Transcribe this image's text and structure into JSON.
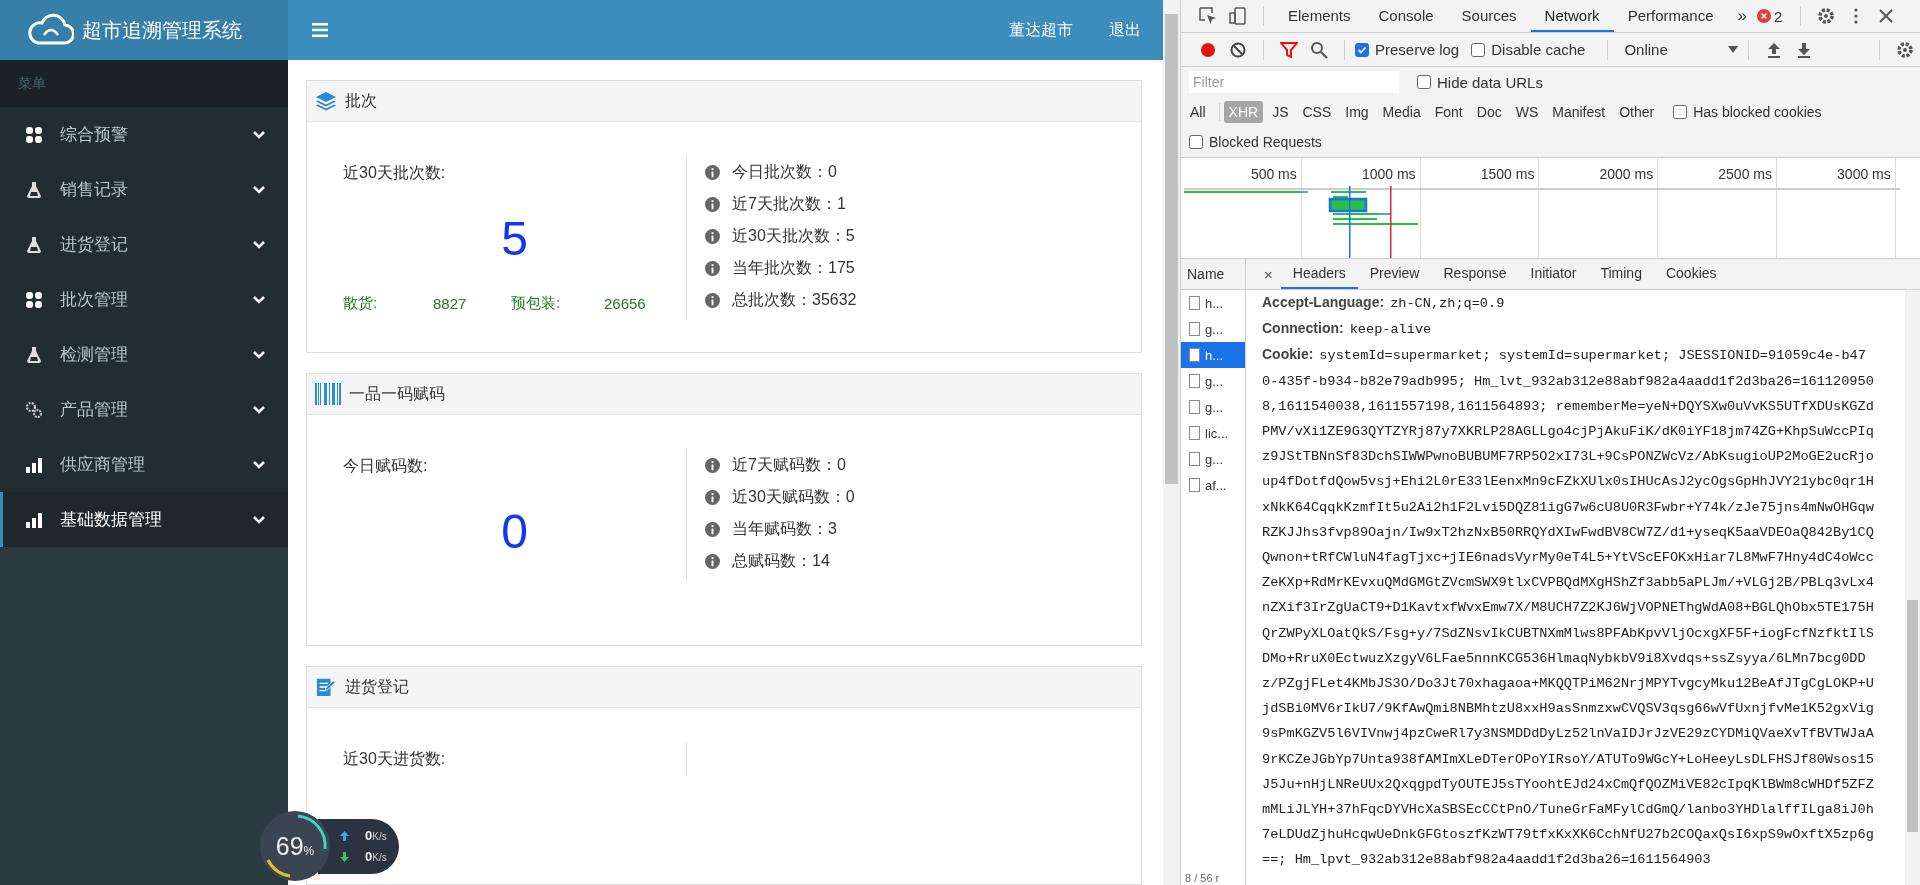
{
  "app": {
    "title": "超市追溯管理系统",
    "user": "董达超市",
    "logout": "退出"
  },
  "sidebar": {
    "heading": "菜单",
    "items": [
      {
        "label": "综合预警",
        "selected": false
      },
      {
        "label": "销售记录",
        "selected": false
      },
      {
        "label": "进货登记",
        "selected": false
      },
      {
        "label": "批次管理",
        "selected": false
      },
      {
        "label": "检测管理",
        "selected": false
      },
      {
        "label": "产品管理",
        "selected": false
      },
      {
        "label": "供应商管理",
        "selected": false
      },
      {
        "label": "基础数据管理",
        "selected": true
      }
    ]
  },
  "cards": [
    {
      "title": "批次",
      "main_label": "近30天批次数:",
      "main_value": "5",
      "breakdown": [
        {
          "label": "散货:",
          "value": "8827"
        },
        {
          "label": "预包装:",
          "value": "26656"
        }
      ],
      "stats": [
        "今日批次数：0",
        "近7天批次数：1",
        "近30天批次数：5",
        "当年批次数：175",
        "总批次数：35632"
      ]
    },
    {
      "title": "一品一码赋码",
      "main_label": "今日赋码数:",
      "main_value": "0",
      "stats": [
        "近7天赋码数：0",
        "近30天赋码数：0",
        "当年赋码数：3",
        "总赋码数：14"
      ]
    },
    {
      "title": "进货登记",
      "main_label": "近30天进货数:"
    }
  ],
  "speed_widget": {
    "percent": "69",
    "percent_unit": "%",
    "upload": "0",
    "upload_unit": "K/s",
    "download": "0",
    "download_unit": "K/s"
  },
  "devtools": {
    "tabs": [
      {
        "label": "Elements",
        "selected": false
      },
      {
        "label": "Console",
        "selected": false
      },
      {
        "label": "Sources",
        "selected": false
      },
      {
        "label": "Network",
        "selected": true
      },
      {
        "label": "Performance",
        "selected": false
      }
    ],
    "more": "»",
    "errors": "2",
    "preserve_log": {
      "label": "Preserve log",
      "checked": true
    },
    "disable_cache": {
      "label": "Disable cache",
      "checked": false
    },
    "throttling": "Online",
    "filter": {
      "placeholder": "Filter"
    },
    "hide_data_urls": {
      "label": "Hide data URLs",
      "checked": false
    },
    "types": [
      {
        "label": "All",
        "selected": false
      },
      {
        "label": "XHR",
        "selected": true
      },
      {
        "label": "JS",
        "selected": false
      },
      {
        "label": "CSS",
        "selected": false
      },
      {
        "label": "Img",
        "selected": false
      },
      {
        "label": "Media",
        "selected": false
      },
      {
        "label": "Font",
        "selected": false
      },
      {
        "label": "Doc",
        "selected": false
      },
      {
        "label": "WS",
        "selected": false
      },
      {
        "label": "Manifest",
        "selected": false
      },
      {
        "label": "Other",
        "selected": false
      }
    ],
    "has_blocked_cookies": {
      "label": "Has blocked cookies",
      "checked": false
    },
    "blocked_requests": {
      "label": "Blocked Requests",
      "checked": false
    },
    "timeline": {
      "ticks": [
        "500 ms",
        "1000 ms",
        "1500 ms",
        "2000 ms",
        "2500 ms",
        "3000 ms"
      ]
    },
    "requests": {
      "heading": "Name",
      "rows": [
        {
          "name": "h...",
          "selected": false
        },
        {
          "name": "g...",
          "selected": false
        },
        {
          "name": "h...",
          "selected": true
        },
        {
          "name": "g...",
          "selected": false
        },
        {
          "name": "g...",
          "selected": false
        },
        {
          "name": "lic...",
          "selected": false
        },
        {
          "name": "g...",
          "selected": false
        },
        {
          "name": "af...",
          "selected": false
        }
      ],
      "summary": "8 / 56 r"
    },
    "details": {
      "close": "×",
      "tabs": [
        {
          "label": "Headers",
          "selected": true
        },
        {
          "label": "Preview",
          "selected": false
        },
        {
          "label": "Response",
          "selected": false
        },
        {
          "label": "Initiator",
          "selected": false
        },
        {
          "label": "Timing",
          "selected": false
        },
        {
          "label": "Cookies",
          "selected": false
        }
      ],
      "headers": [
        {
          "name": "Accept-Language:",
          "value": "zh-CN,zh;q=0.9"
        },
        {
          "name": "Connection:",
          "value": "keep-alive"
        },
        {
          "name": "Cookie:",
          "value": "systemId=supermarket; systemId=supermarket; JSESSIONID=91059c4e-b470-435f-b934-b82e79adb995; Hm_lvt_932ab312e88abf982a4aadd1f2d3ba26=1611209508,1611540038,1611557198,1611564893; rememberMe=yeN+DQYSXw0uVvKS5UTfXDUsKGZdPMV/vXi1ZE9G3QYTZYRj87y7XKRLP28AGLLgo4cjPjAkuFiK/dK0iYF18jm74ZG+KhpSuWccPIqz9JStTBNnSf83DchSIWWPwnoBUBUMF7RP5O2xI73L+9CsPONZWcVz/AbKsugioUP2MoGE2ucRjoup4fDotfdQow5vsj+Ehi2L0rE33lEenxMn9cFZkXUlx0sIHUcAsJ2ycOgsGpHhJVY21ybc0qr1HxNkK64CqqkKzmfIt5u2Ai2h1F2Lvi5DQZ81igG7w6cU8U0R3Fwbr+Y74k/zJe75jns4mNwOHGqwRZKJJhs3fvp89Oajn/Iw9xT2hzNxB50RRQYdXIwFwdBV8CW7Z/d1+yseqK5aaVDEOaQ842By1CQQwnon+tRfCWluN4fagTjxc+jIE6nadsVyrMy0eT4L5+YtVScEFOKxHiar7L8MwF7Hny4dC4oWccZeKXp+RdMrKEvxuQMdGMGtZVcmSWX9tlxCVPBQdMXgHShZf3abb5aPLJm/+VLGj2B/PBLq3vLx4nZXif3IrZgUaCT9+D1KavtxfWvxEmw7X/M8UCH7Z2KJ6WjVOPNEThgWdA08+BGLQhObx5TE175HQrZWPyXLOatQkS/Fsg+y/7SdZNsvIkCUBTNXmMlws8PFAbKpvVljOcxgXF5F+iogFcfNzfktIlSDMo+RruX0EctwuzXzgyV6LFae5nnnKCG536HlmaqNybkbV9i8Xvdqs+ssZsyya/6LMn7bcg0DDz/PZgjFLet4KMbJS3O/Do3Jt70xhagaoa+MKQQTPiM62NrjMPYTvgcyMku12BeAfJTgCgLOKP+UjdSBi0MV6rIkU7/9KfAwQmi8NBMhtzU8xxH9asSnmzxwCVQSV3qsg66wVfUxnjfvMe1K52gxVig9sPmKGZV5l6VIVnwj4pzCweRl7y3NSMDDdDyLz52lnVaIDJrJzVE29zCYDMiQVaeXvTfBVTWJaA9rKCZeJGbYp7Unta938fAMImXLeDTerOPoYIRsoY/ATUTo9WGcY+LoHeeyLsDLFHSJf80Wsos15J5Ju+nHjLNReUUx2QxqgpdTyOUTEJ5sTYoohtEJd24xCmQfQOZMiVE82cIpqKlBWm8cWHDf5ZFZmMLiJLYH+37hFqcDYVHcXaSBSEcCCtPnO/TuneGrFaMFylCdGmQ/lanbo3YHDlalffILga8iJ0h7eLDUdZjhuHcqwUeDnkGFGtoszfKzWT79tfxKxXK6CchNfU27b2COQaxQsI6xpS9wOxftX5zp6g==; Hm_lpvt_932ab312e88abf982a4aadd1f2d3ba26=1611564903"
        }
      ]
    }
  }
}
